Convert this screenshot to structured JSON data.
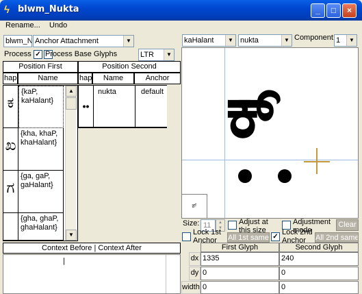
{
  "window": {
    "title": "blwm_Nukta",
    "min": "_",
    "max": "□",
    "close": "×"
  },
  "menu": {
    "rename": "Rename...",
    "undo": "Undo"
  },
  "left": {
    "lookup_name": "blwm_N",
    "lookup_type": "Anchor Attachment",
    "process_label": "Process",
    "process_checked": "✓",
    "process_base_glyphs": "Process Base Glyphs",
    "direction": "LTR",
    "col_first": "Position First",
    "col_second": "Position Second",
    "sub_glyph": "hap",
    "sub_name": "Name",
    "sub_anchor": "Anchor",
    "first_rows": [
      {
        "glyph": "ಕ",
        "name": "{kaP, kaHalant}"
      },
      {
        "glyph": "ಖ",
        "name": "{kha, khaP, khaHalant}"
      },
      {
        "glyph": "ಗ",
        "name": "{ga, gaP, gaHalant}"
      },
      {
        "glyph": "",
        "name": "{gha, ghaP, ghaHalant}"
      }
    ],
    "second_rows": [
      {
        "glyph": "••",
        "name": "nukta",
        "anchor": "default"
      }
    ],
    "context_header": "Context Before | Context After",
    "context_text": "|"
  },
  "right": {
    "first_glyph": "kaHalant",
    "second_glyph": "nukta",
    "component_label": "Component:",
    "component_value": "1",
    "preview_glyph": "ಕ್",
    "thumb_glyph": "ಕ್",
    "size_label": "Size:",
    "size_value": "11",
    "adjust_size": "Adjust at this size",
    "adjustment_mode": "Adjustment mode",
    "clear": "Clear",
    "lock_1st": "Lock 1st Anchor",
    "all_1st_same": "All 1st same",
    "lock_2nd": "Lock 2nd Anchor",
    "lock_2nd_checked": "✓",
    "all_2nd_same": "All 2nd same",
    "table_first": "First Glyph",
    "table_second": "Second Glyph",
    "rows": [
      {
        "label": "dx",
        "first": "1335",
        "second": "240"
      },
      {
        "label": "dy",
        "first": "0",
        "second": "0"
      },
      {
        "label": "width",
        "first": "0",
        "second": "0"
      }
    ]
  },
  "colors": {
    "title_bar": "#0047d0",
    "crosshair": "#c8963c",
    "grid_line": "#9bbce0"
  }
}
